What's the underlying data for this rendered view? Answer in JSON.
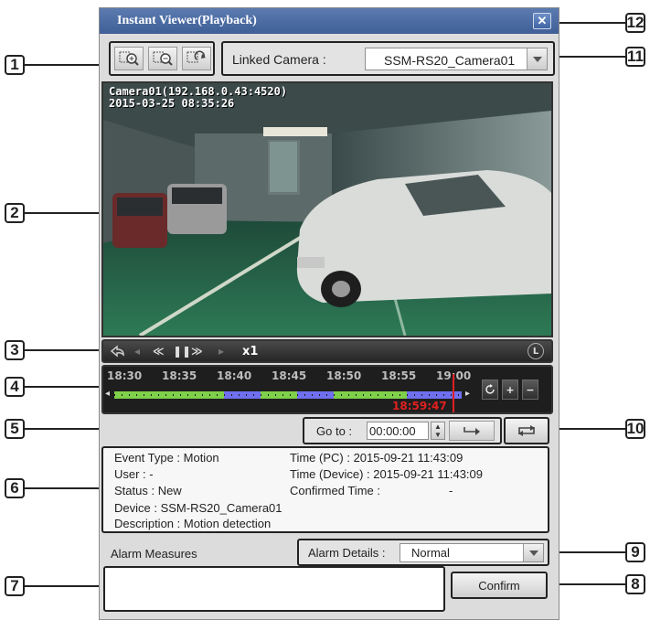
{
  "window": {
    "title": "Instant Viewer(Playback)",
    "close_label": "✕"
  },
  "toolbar": {
    "buttons": [
      "zoom-in-icon",
      "zoom-out-icon",
      "refresh-grid-icon"
    ]
  },
  "linked_camera": {
    "label": "Linked Camera :",
    "value": "SSM-RS20_Camera01"
  },
  "video": {
    "camera_info": "Camera01(192.168.0.43:4520)",
    "timestamp": "2015-03-25 08:35:26"
  },
  "playback": {
    "speed": "x1",
    "live_label": "L"
  },
  "timeline": {
    "ticks": [
      "18:30",
      "18:35",
      "18:40",
      "18:45",
      "18:50",
      "18:55",
      "19:00"
    ],
    "current_time": "18:59:47",
    "zoom_in_label": "+",
    "zoom_out_label": "−"
  },
  "goto": {
    "label": "Go to :",
    "value": "00:00:00"
  },
  "event": {
    "type": "Event Type : Motion",
    "user": "User : -",
    "status": "Status : New",
    "device": "Device : SSM-RS20_Camera01",
    "description": "Description : Motion detection",
    "time_pc": "Time (PC) : 2015-09-21 11:43:09",
    "time_device": "Time (Device) : 2015-09-21 11:43:09",
    "confirmed_time_label": "Confirmed Time :",
    "confirmed_time_value": "-"
  },
  "alarm": {
    "measures_label": "Alarm Measures",
    "details_label": "Alarm Details :",
    "details_value": "Normal",
    "confirm_label": "Confirm"
  },
  "callouts": [
    "1",
    "2",
    "3",
    "4",
    "5",
    "6",
    "7",
    "8",
    "9",
    "10",
    "11",
    "12"
  ],
  "colors": {
    "title_bar": "#4a6aa3",
    "timeline_red": "#e02020",
    "timeline_green": "#7fd04a",
    "timeline_blue": "#6f6ff0"
  }
}
